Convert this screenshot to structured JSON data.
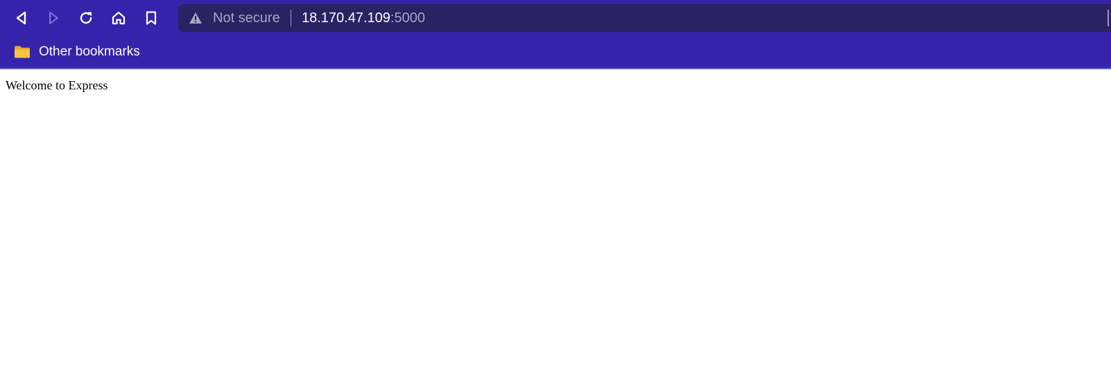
{
  "theme": {
    "toolbar_bg": "#3623ac",
    "omnibox_bg": "#2a2262",
    "muted_text": "#a9a6c4",
    "folder_color": "#f6c343"
  },
  "toolbar": {
    "buttons": [
      {
        "icon": "back-arrow-icon",
        "enabled": true
      },
      {
        "icon": "forward-arrow-icon",
        "enabled": false
      },
      {
        "icon": "reload-icon",
        "enabled": true
      },
      {
        "icon": "home-icon",
        "enabled": true
      },
      {
        "icon": "bookmark-icon",
        "enabled": true
      }
    ]
  },
  "omnibox": {
    "security_icon": "warning-triangle-icon",
    "security_label": "Not secure",
    "host": "18.170.47.109",
    "port": ":5000"
  },
  "bookmarks_bar": {
    "items": [
      {
        "icon": "folder-icon",
        "label": "Other bookmarks"
      }
    ]
  },
  "page": {
    "text": "Welcome to Express"
  }
}
